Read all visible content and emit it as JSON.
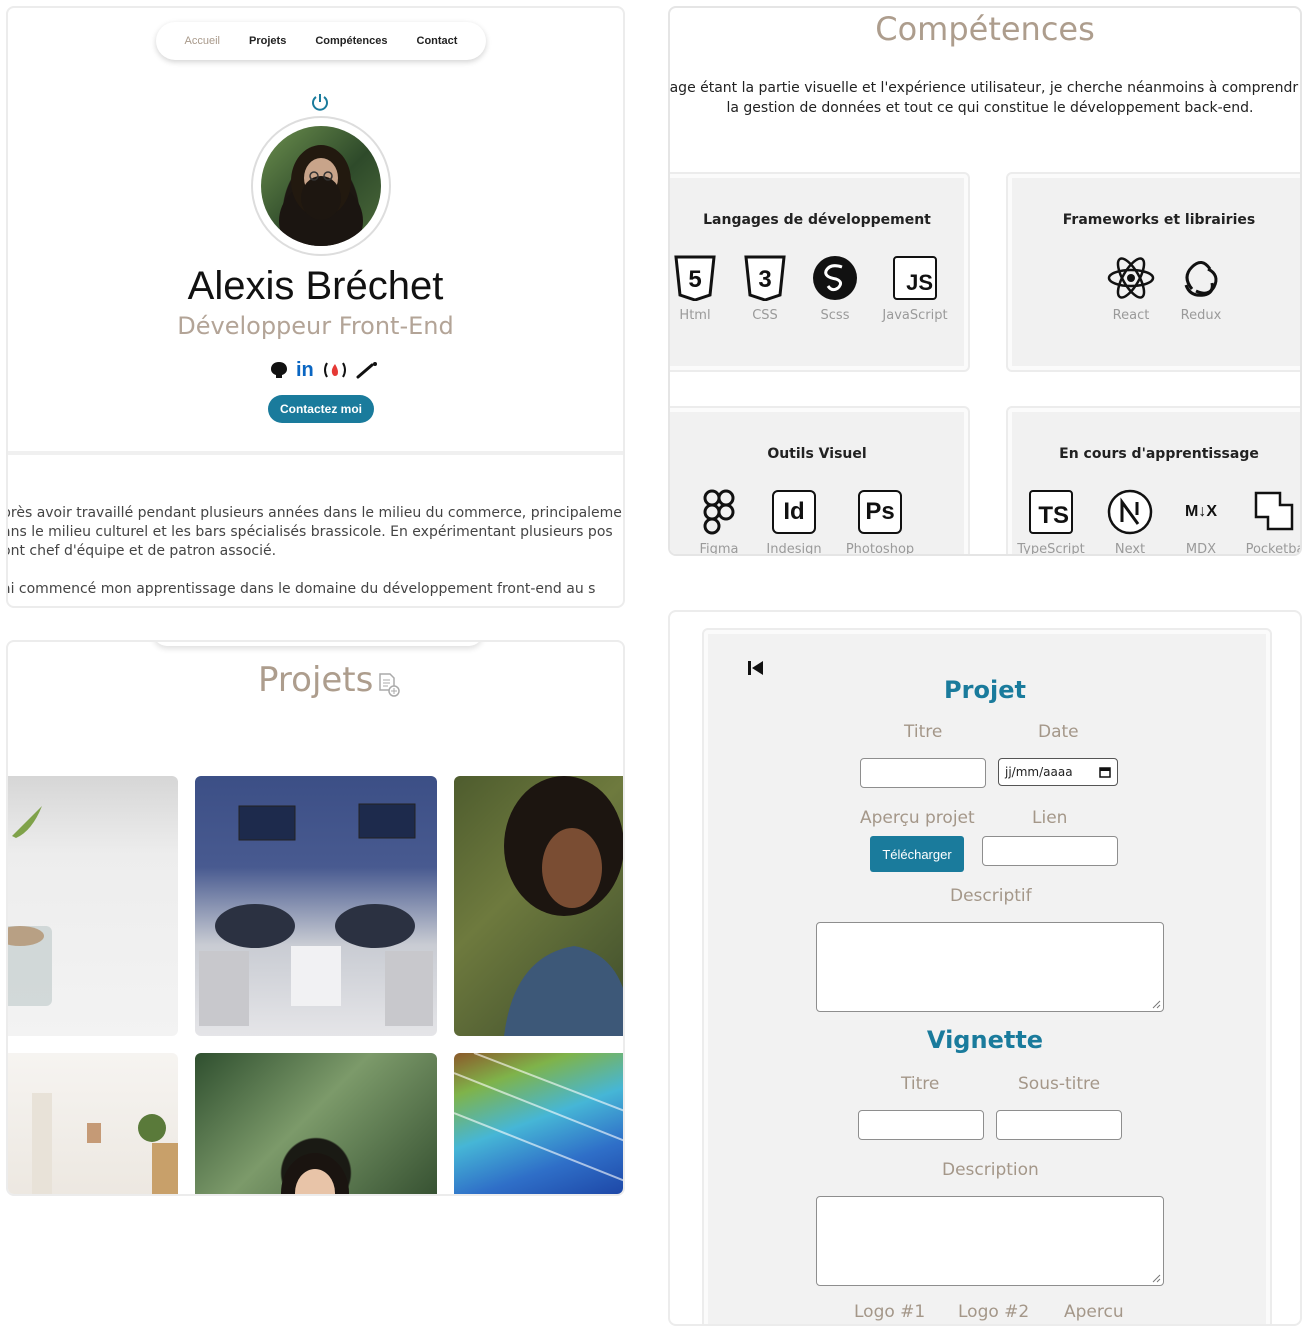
{
  "nav": {
    "items": [
      "Accueil",
      "Projets",
      "Compétences",
      "Contact"
    ],
    "active": "Accueil"
  },
  "hero": {
    "name": "Alexis Bréchet",
    "role": "Développeur Front-End",
    "socials": [
      "github-icon",
      "linkedin-icon",
      "freecodecamp-icon",
      "dev-icon"
    ],
    "linkedin_label": "in",
    "contact_button": "Contactez moi",
    "about": [
      "près avoir travaillé pendant plusieurs années dans le milieu du commerce, principaleme",
      "ans le milieu culturel et les bars spécialisés brassicole. En expérimentant plusieurs pos",
      "ont chef d'équipe et de patron associé.",
      "ai commencé mon apprentissage dans le domaine du développement front-end au s"
    ]
  },
  "skills": {
    "title": "Compétences",
    "intro_line1": "rage étant la partie visuelle et l'expérience utilisateur, je cherche néanmoins à comprendr",
    "intro_line2": "la gestion de données et tout ce qui constitue le développement back-end.",
    "cards": [
      {
        "title": "Langages de développement",
        "items": [
          "Html",
          "CSS",
          "Scss",
          "JavaScript"
        ]
      },
      {
        "title": "Frameworks et librairies",
        "items": [
          "React",
          "Redux"
        ]
      },
      {
        "title": "Outils Visuel",
        "items": [
          "Figma",
          "Indesign",
          "Photoshop"
        ]
      },
      {
        "title": "En cours d'apprentissage",
        "items": [
          "TypeScript",
          "Next",
          "MDX",
          "Pocketba"
        ]
      }
    ],
    "glyphs": {
      "js": "JS",
      "id": "Id",
      "ps": "Ps",
      "ts": "TS",
      "mdx": "M↓X"
    }
  },
  "projects": {
    "title": "Projets"
  },
  "form": {
    "project_heading": "Projet",
    "title_label": "Titre",
    "date_label": "Date",
    "date_placeholder": "jj/mm/aaaa",
    "preview_label": "Aperçu projet",
    "link_label": "Lien",
    "upload_button": "Télécharger",
    "descriptif_label": "Descriptif",
    "vignette_heading": "Vignette",
    "v_title_label": "Titre",
    "v_subtitle_label": "Sous-titre",
    "description_label": "Description",
    "logo1_label": "Logo #1",
    "logo2_label": "Logo #2",
    "apercu_label": "Apercu"
  },
  "colors": {
    "accent": "#1a7b9c",
    "beige": "#ad9d8d"
  }
}
